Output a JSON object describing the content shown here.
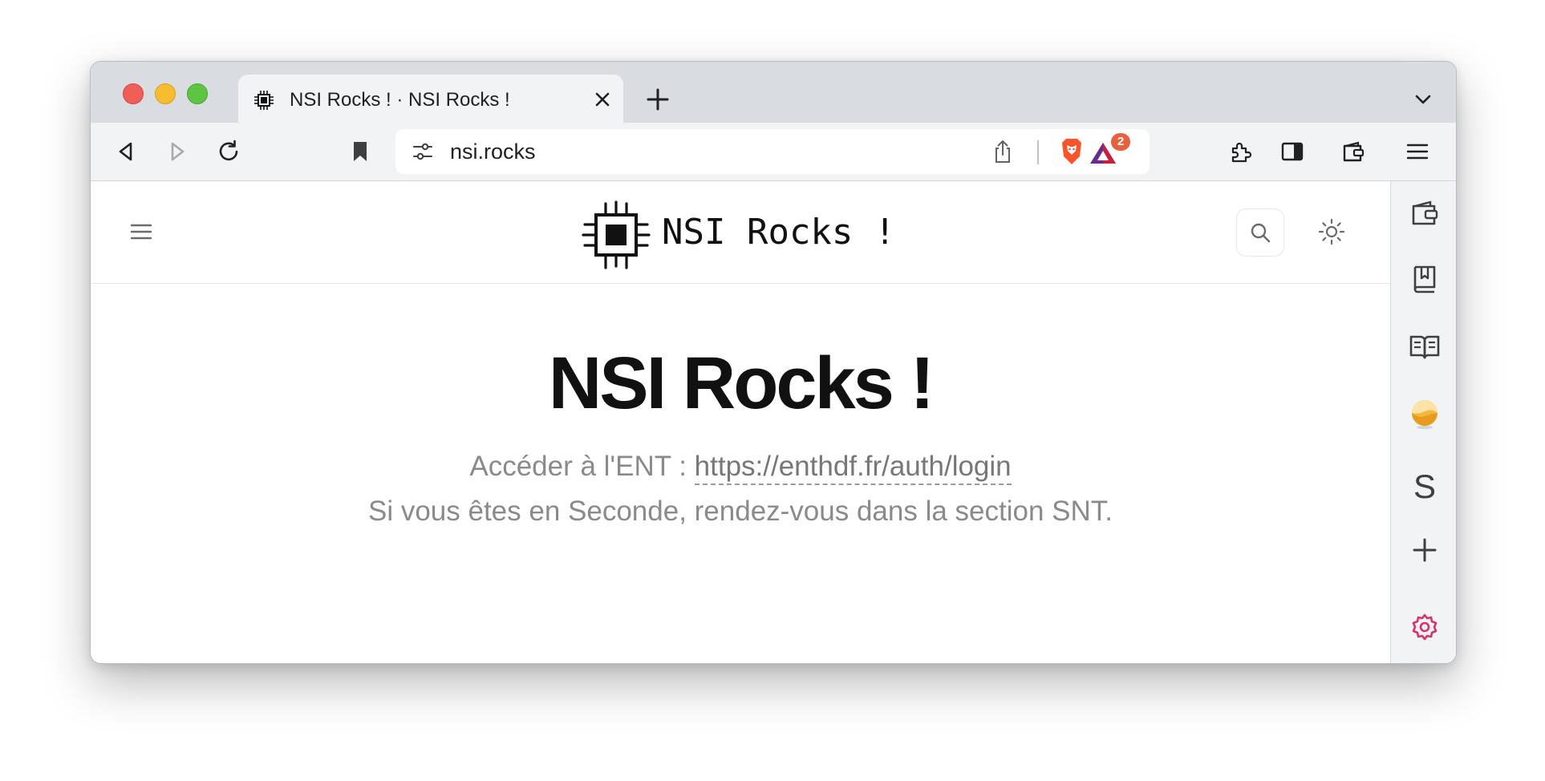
{
  "browser": {
    "tab": {
      "title": "NSI Rocks ! · NSI Rocks !",
      "favicon": "chip-icon"
    },
    "toolbar": {
      "url": "nsi.rocks",
      "rewards_badge": "2",
      "icons": [
        "back-icon",
        "forward-icon",
        "reload-icon",
        "bookmark-icon",
        "site-settings-icon",
        "share-icon",
        "brave-shields-icon",
        "brave-rewards-icon",
        "extensions-icon",
        "sidebar-toggle-icon",
        "wallet-icon",
        "menu-icon"
      ]
    },
    "sidebar": {
      "icons": [
        "wallet-icon",
        "bookmarks-icon",
        "reading-list-icon",
        "leo-ai-icon",
        "add-icon",
        "settings-icon"
      ],
      "letter_item": "S"
    }
  },
  "site": {
    "title": "NSI Rocks !",
    "hero_title": "NSI Rocks !",
    "ent_prefix": "Accéder à l'ENT : ",
    "ent_link": "https://enthdf.fr/auth/login",
    "subtitle": "Si vous êtes en Seconde, rendez-vous dans la section SNT."
  },
  "colors": {
    "tabstrip": "#d9dce0",
    "toolbar": "#f1f3f4",
    "brave_orange": "#fb542b",
    "rewards_badge": "#e8603c",
    "settings_pink": "#d6336c"
  }
}
